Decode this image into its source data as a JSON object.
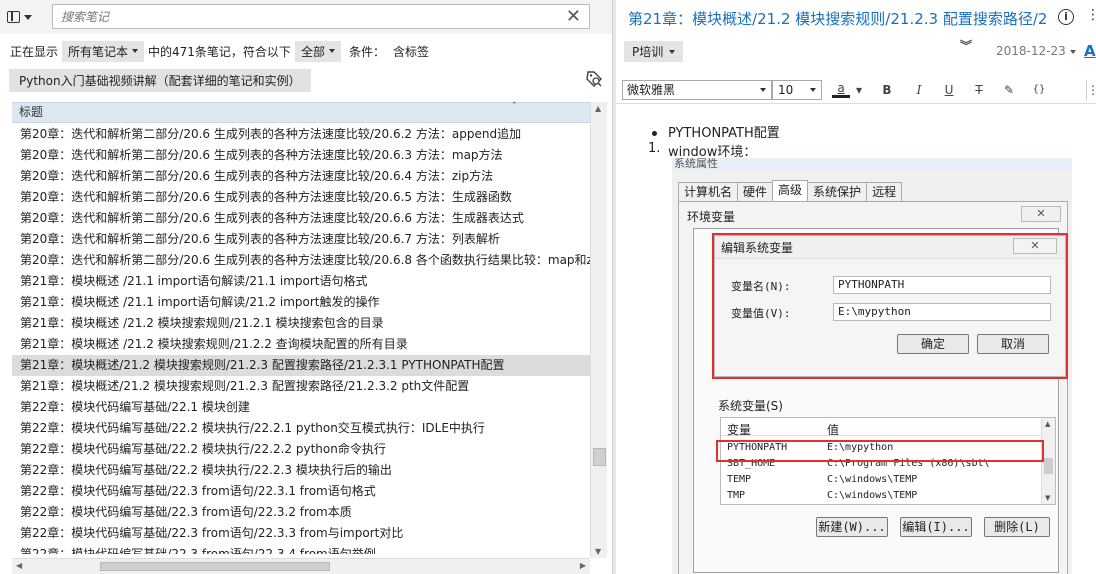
{
  "search": {
    "placeholder": "搜索笔记",
    "clear": "✕"
  },
  "filter": {
    "showing_label": "正在显示",
    "notebook_select": "所有笔记本",
    "count_text": "中的471条笔记，符合以下",
    "all_select": "全部",
    "condition_label": "条件：",
    "condition_value": "含标签"
  },
  "tag_chip": "Python入门基础视频讲解（配套详细的笔记和实例）",
  "list": {
    "column_title": "标题",
    "sort_glyph": "ˆ",
    "selected_index": 11,
    "rows": [
      "第20章：迭代和解析第二部分/20.6 生成列表的各种方法速度比较/20.6.2 方法：append追加",
      "第20章：迭代和解析第二部分/20.6 生成列表的各种方法速度比较/20.6.3 方法：map方法",
      "第20章：迭代和解析第二部分/20.6 生成列表的各种方法速度比较/20.6.4 方法：zip方法",
      "第20章：迭代和解析第二部分/20.6 生成列表的各种方法速度比较/20.6.5 方法：生成器函数",
      "第20章：迭代和解析第二部分/20.6 生成列表的各种方法速度比较/20.6.6 方法：生成器表达式",
      "第20章：迭代和解析第二部分/20.6 生成列表的各种方法速度比较/20.6.7 方法：列表解析",
      "第20章：迭代和解析第二部分/20.6 生成列表的各种方法速度比较/20.6.8 各个函数执行结果比较：map和zip",
      "第21章：模块概述 /21.1 import语句解读/21.1 import语句格式",
      "第21章：模块概述 /21.1 import语句解读/21.2 import触发的操作",
      "第21章：模块概述 /21.2 模块搜索规则/21.2.1 模块搜索包含的目录",
      "第21章：模块概述 /21.2 模块搜索规则/21.2.2 查询模块配置的所有目录",
      "第21章：模块概述/21.2 模块搜索规则/21.2.3 配置搜索路径/21.2.3.1 PYTHONPATH配置",
      "第21章：模块概述/21.2 模块搜索规则/21.2.3 配置搜索路径/21.2.3.2 pth文件配置",
      "第22章：模块代码编写基础/22.1 模块创建",
      "第22章：模块代码编写基础/22.2 模块执行/22.2.1 python交互模式执行：IDLE中执行",
      "第22章：模块代码编写基础/22.2 模块执行/22.2.2 python命令执行",
      "第22章：模块代码编写基础/22.2 模块执行/22.2.3 模块执行后的输出",
      "第22章：模块代码编写基础/22.3 from语句/22.3.1 from语句格式",
      "第22章：模块代码编写基础/22.3 from语句/22.3.2 from本质",
      "第22章：模块代码编写基础/22.3 from语句/22.3.3 from与import对比",
      "第22章：模块代码编写基础/22.3 from语句/22.3.4 from语句举例"
    ]
  },
  "note": {
    "title": "第21章：模块概述/21.2 模块搜索规则/21.2.3 配置搜索路径/21.2.3.1 PYTHONPATH配置",
    "notebook": "P培训",
    "date": "2018-12-23",
    "a_glyph": "A",
    "font": "微软雅黑",
    "size": "10",
    "toolbar": {
      "color": "a",
      "bold": "B",
      "italic": "I",
      "underline": "U",
      "strike": "T",
      "highlight": "✎",
      "code": "{}"
    },
    "bullet_text": "PYTHONPATH配置",
    "ordered_num": "1.",
    "ordered_text": "window环境："
  },
  "screenshot": {
    "window_title": "系统属性",
    "tabs": [
      "计算机名",
      "硬件",
      "高级",
      "系统保护",
      "远程"
    ],
    "active_tab": "高级",
    "env_title": "环境变量",
    "close_glyph": "✕",
    "edit_title": "编辑系统变量",
    "name_label": "变量名(N):",
    "name_value": "PYTHONPATH",
    "value_label": "变量值(V):",
    "value_value": "E:\\mypython",
    "ok": "确定",
    "cancel": "取消",
    "sysvars_title": "系统变量(S)",
    "col_var": "变量",
    "col_val": "值",
    "rows": [
      {
        "var": "PYTHONPATH",
        "val": "E:\\mypython"
      },
      {
        "var": "SBT_HOME",
        "val": "C:\\Program Files (x86)\\sbt\\"
      },
      {
        "var": "TEMP",
        "val": "C:\\windows\\TEMP"
      },
      {
        "var": "TMP",
        "val": "C:\\windows\\TEMP"
      }
    ],
    "new_btn": "新建(W)...",
    "edit_btn": "编辑(I)...",
    "delete_btn": "删除(L)"
  }
}
